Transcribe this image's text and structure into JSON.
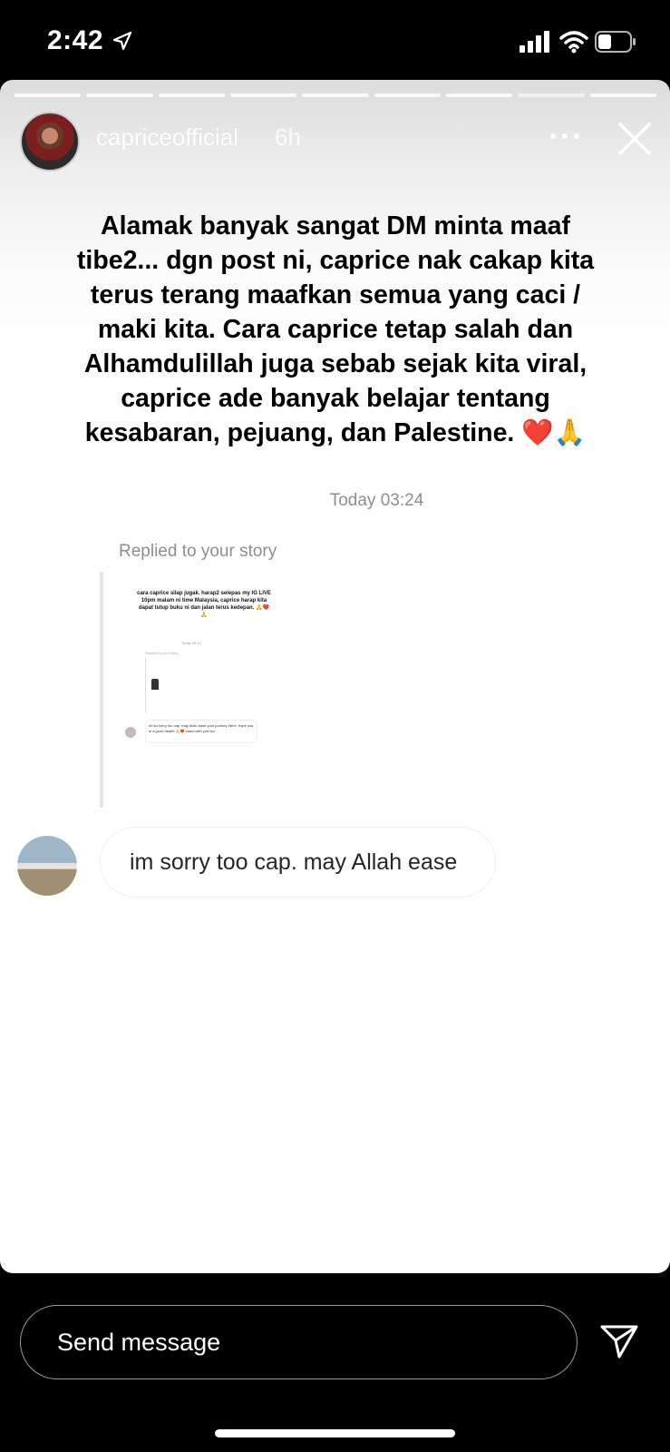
{
  "status_bar": {
    "time": "2:42"
  },
  "story": {
    "segments": 9,
    "username": "capriceofficial",
    "time_ago": "6h",
    "caption": "Alamak banyak sangat DM minta maaf tibe2... dgn post ni, caprice nak cakap kita terus terang maafkan semua yang caci / maki kita. Cara caprice tetap salah dan Alhamdulillah juga sebab sejak kita viral, caprice ade banyak belajar tentang kesabaran, pejuang, dan Palestine. ❤️🙏",
    "dm": {
      "timestamp": "Today 03:24",
      "replied_label": "Replied to your story",
      "preview_text": "cara caprice silap jugak. harap2 selepas my IG LIVE 10pm malam ni time Malaysia, caprice harap kita dapat tutup buku ni dan jalan terus kedepan. 🙏❤️🙏",
      "preview_today": "Today 00:10",
      "preview_replied": "Replied to your story",
      "preview_bubble": "Im so sorry too cap. may Allah ease your journey there. hope you in a good health 🙏❤️ stand with you bro",
      "message": "im sorry too cap. may Allah ease"
    }
  },
  "composer": {
    "placeholder": "Send message"
  }
}
